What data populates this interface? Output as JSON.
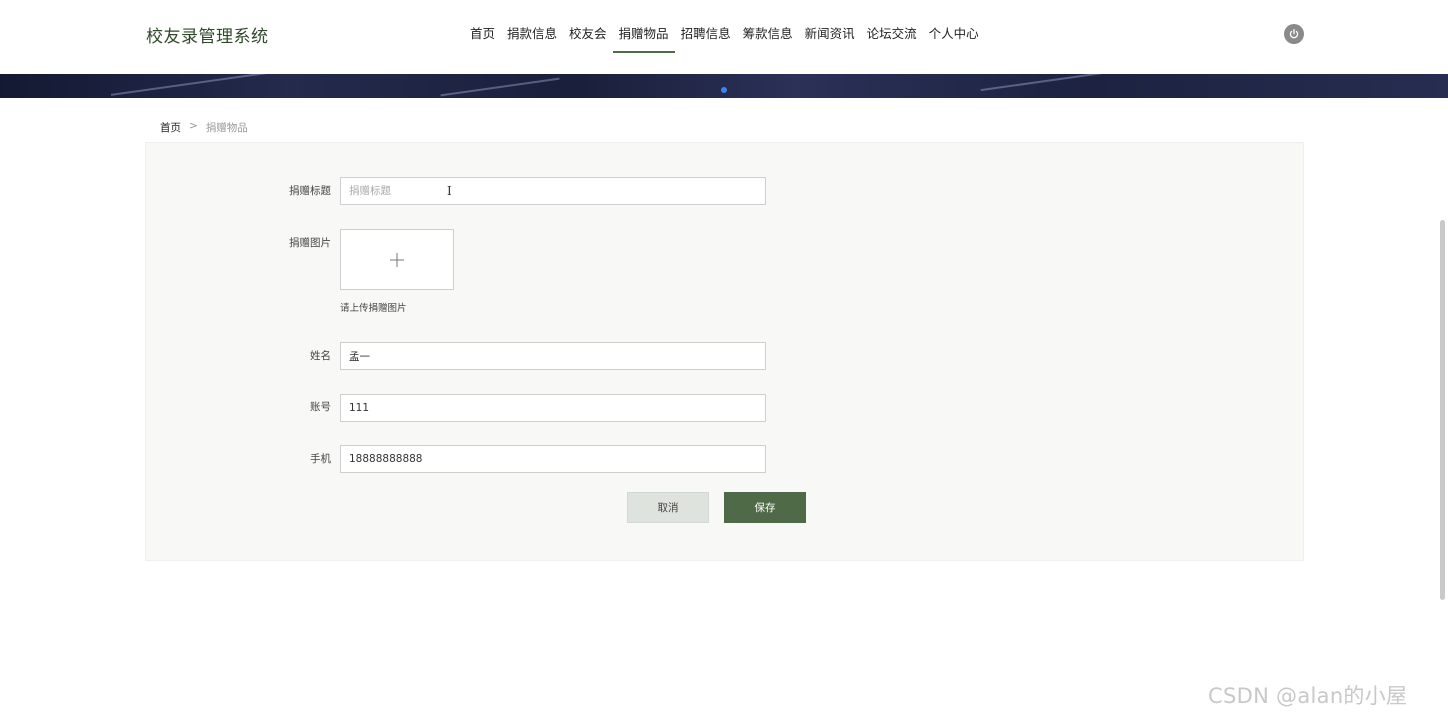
{
  "header": {
    "brand": "校友录管理系统",
    "nav": [
      {
        "label": "首页",
        "active": false
      },
      {
        "label": "捐款信息",
        "active": false
      },
      {
        "label": "校友会",
        "active": false
      },
      {
        "label": "捐赠物品",
        "active": true
      },
      {
        "label": "招聘信息",
        "active": false
      },
      {
        "label": "筹款信息",
        "active": false
      },
      {
        "label": "新闻资讯",
        "active": false
      },
      {
        "label": "论坛交流",
        "active": false
      },
      {
        "label": "个人中心",
        "active": false
      }
    ],
    "logout_icon": "power-icon"
  },
  "breadcrumb": {
    "home": "首页",
    "separator": ">",
    "current": "捐赠物品"
  },
  "form": {
    "title_label": "捐赠标题",
    "title_placeholder": "捐赠标题",
    "title_value": "",
    "image_label": "捐赠图片",
    "image_hint": "请上传捐赠图片",
    "name_label": "姓名",
    "name_value": "孟一",
    "account_label": "账号",
    "account_value": "111",
    "phone_label": "手机",
    "phone_value": "18888888888",
    "cancel_label": "取消",
    "save_label": "保存"
  },
  "watermark": "CSDN @alan的小屋",
  "colors": {
    "accent": "#4f6a47",
    "brand_text": "#2f4a2b",
    "panel_bg": "#f8f8f6"
  }
}
